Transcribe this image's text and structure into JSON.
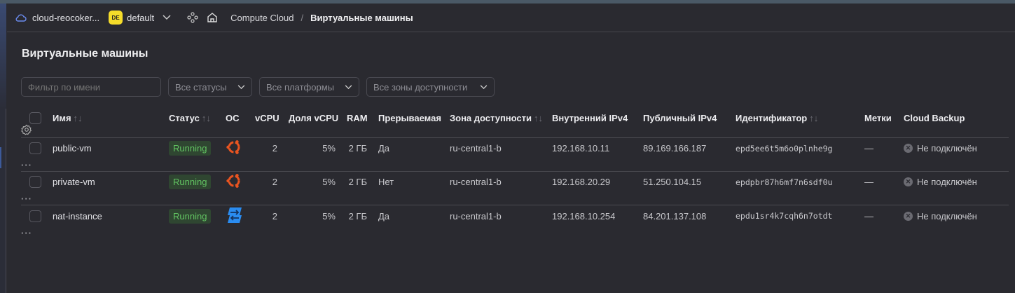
{
  "header": {
    "cloud": "cloud-reocoker...",
    "folder_badge": "DE",
    "folder": "default",
    "service": "Compute Cloud",
    "separator": "/",
    "page": "Виртуальные машины"
  },
  "title": "Виртуальные машины",
  "filters": {
    "name_placeholder": "Фильтр по имени",
    "status": "Все статусы",
    "platform": "Все платформы",
    "zone": "Все зоны доступности"
  },
  "columns": {
    "name": "Имя",
    "status": "Статус",
    "os": "ОС",
    "vcpu": "vCPU",
    "share": "Доля vCPU",
    "ram": "RAM",
    "preemptible": "Прерываемая",
    "zone": "Зона доступности",
    "internal": "Внутренний IPv4",
    "public": "Публичный IPv4",
    "id": "Идентификатор",
    "labels": "Метки",
    "backup": "Cloud Backup",
    "sort_icon": "↑↓"
  },
  "rows": [
    {
      "name": "public-vm",
      "status": "Running",
      "os": "ubuntu",
      "vcpu": "2",
      "share": "5%",
      "ram": "2 ГБ",
      "preemptible": "Да",
      "zone": "ru-central1-b",
      "internal": "192.168.10.11",
      "public": "89.169.166.187",
      "id": "epd5ee6t5m6o0plnhe9g",
      "labels": "—",
      "backup": "Не подключён"
    },
    {
      "name": "private-vm",
      "status": "Running",
      "os": "ubuntu",
      "vcpu": "2",
      "share": "5%",
      "ram": "2 ГБ",
      "preemptible": "Нет",
      "zone": "ru-central1-b",
      "internal": "192.168.20.29",
      "public": "51.250.104.15",
      "id": "epdpbr87h6mf7n6sdf0u",
      "labels": "—",
      "backup": "Не подключён"
    },
    {
      "name": "nat-instance",
      "status": "Running",
      "os": "nat",
      "vcpu": "2",
      "share": "5%",
      "ram": "2 ГБ",
      "preemptible": "Да",
      "zone": "ru-central1-b",
      "internal": "192.168.10.254",
      "public": "84.201.137.108",
      "id": "epdu1sr4k7cqh6n7otdt",
      "labels": "—",
      "backup": "Не подключён"
    }
  ],
  "colors": {
    "accent": "#f5dc2a",
    "running": "#62c462",
    "ubuntu": "#e95420",
    "nat": "#2a8cf0"
  }
}
